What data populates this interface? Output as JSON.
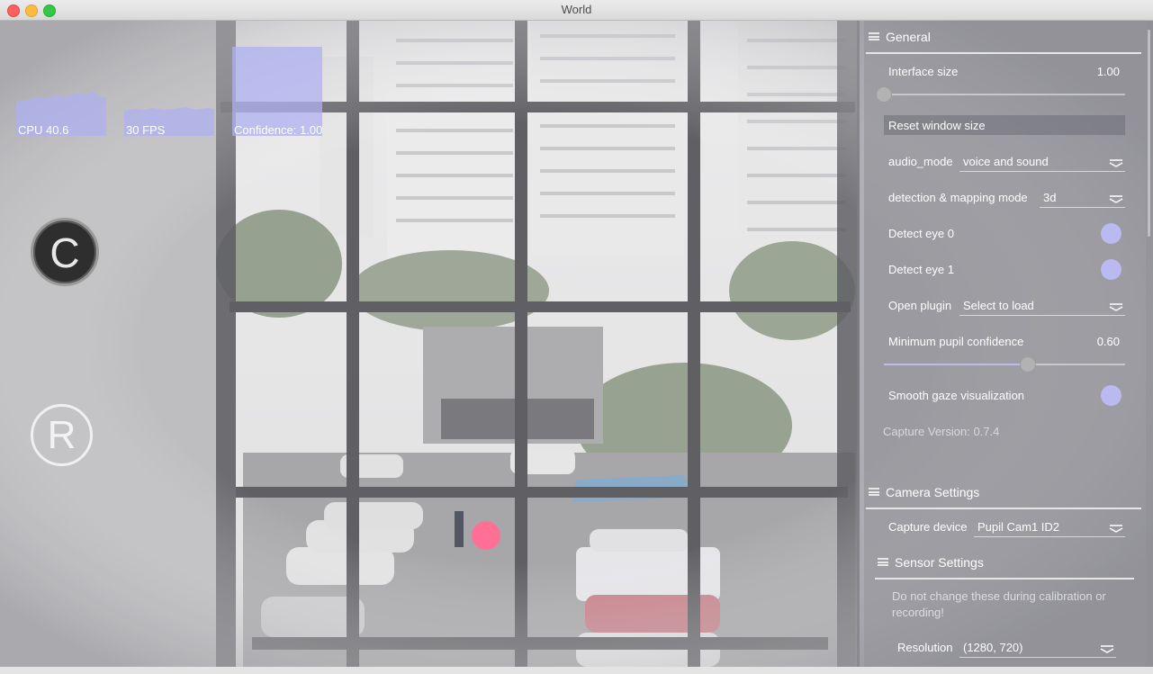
{
  "window": {
    "title": "World"
  },
  "overlay": {
    "cpu_label": "CPU 40.6",
    "fps_label": "30 FPS",
    "confidence_label": "Confidence: 1.00",
    "calibrate_glyph": "C",
    "record_glyph": "R",
    "graph_color": "#aeb0f0",
    "gaze_color": "#ff6f96"
  },
  "general": {
    "title": "General",
    "interface_size_label": "Interface size",
    "interface_size_value": "1.00",
    "interface_size_fraction": 0.0,
    "reset_window_size_label": "Reset window size",
    "audio_mode_label": "audio_mode",
    "audio_mode_value": "voice and sound",
    "detection_mode_label": "detection & mapping mode",
    "detection_mode_value": "3d",
    "detect_eye0_label": "Detect eye 0",
    "detect_eye0_on": true,
    "detect_eye1_label": "Detect eye 1",
    "detect_eye1_on": true,
    "open_plugin_label": "Open plugin",
    "open_plugin_value": "Select to load",
    "min_pupil_conf_label": "Minimum pupil confidence",
    "min_pupil_conf_value": "0.60",
    "min_pupil_conf_fraction": 0.6,
    "smooth_gaze_label": "Smooth gaze visualization",
    "smooth_gaze_on": true,
    "capture_version": "Capture Version: 0.7.4"
  },
  "camera": {
    "title": "Camera Settings",
    "capture_device_label": "Capture device",
    "capture_device_value": "Pupil Cam1 ID2",
    "sensor_title": "Sensor Settings",
    "sensor_note": "Do not change these during calibration or recording!",
    "resolution_label": "Resolution",
    "resolution_value": "(1280, 720)"
  },
  "icons": {
    "menu": "hamburger-icon",
    "dropdown": "chevron-down-icon"
  },
  "accent_color": "#babaf0"
}
